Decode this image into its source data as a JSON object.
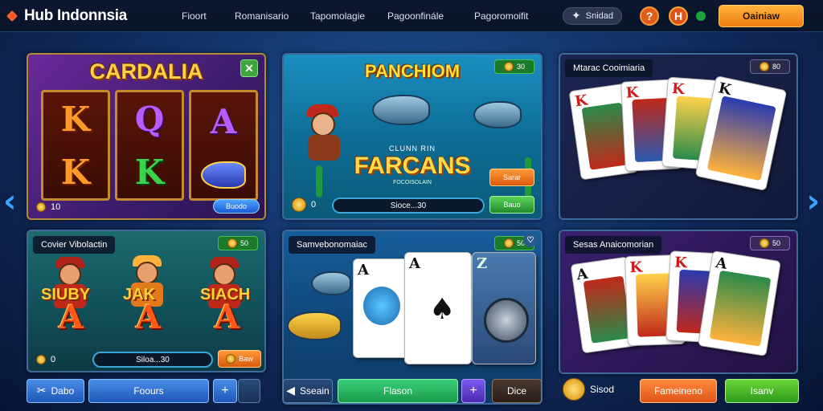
{
  "header": {
    "logo_text": "Hub Indonnsia",
    "nav": [
      "Fioort",
      "Romanisario",
      "Tapomolagie",
      "Pagoonfinále",
      "Pagoromoifit"
    ],
    "pill_label": "Snidad",
    "help_label": "?",
    "h_label": "H",
    "cta_label": "Oainiaw"
  },
  "cards": {
    "c1": {
      "title": "CARDALIA",
      "footer_value": "10",
      "footer_btn": "Buodo",
      "reel1": [
        "K",
        "K"
      ],
      "reel2": [
        "Q",
        "K"
      ],
      "reel3": [
        "A"
      ]
    },
    "c2": {
      "title": "PANCHIOM",
      "badge": "30",
      "sub": "CLUNN RIN",
      "main": "FARCANS",
      "sub2": "FOCOISOLAIN",
      "pink_btn": "Sarar",
      "footer_value": "0",
      "field": "Sioce...30",
      "green_btn": "Bauo"
    },
    "c3": {
      "title": "Mtarac Cooimiaria",
      "badge": "80",
      "cards": [
        "K",
        "K",
        "K",
        "K"
      ]
    },
    "c4": {
      "title": "Covier Vibolactin",
      "badge": "50",
      "words": [
        "SIUBY",
        "JAK",
        "SIACH"
      ],
      "letters": [
        "A",
        "A",
        "A"
      ],
      "footer_value": "0",
      "field": "Siloa...30",
      "btn": "Baw"
    },
    "c5": {
      "title": "Samvebonomaiac",
      "badge": "50",
      "card1": "A",
      "card2": "A",
      "card3": "Z"
    },
    "c6": {
      "title": "Sesas Anaicomorian",
      "badge": "50",
      "cards": [
        "A",
        "K",
        "K",
        "A"
      ]
    }
  },
  "bottom": {
    "b1": "Dabo",
    "b2": "Foours",
    "b3": "+",
    "b4": "Sseain",
    "b5": "Flason",
    "b6": "+",
    "b7": "Dice",
    "coin_label": "Sisod",
    "b8": "Fameineno",
    "b9": "Isanv"
  },
  "colors": {
    "accent": "#ef7d12",
    "brand": "#ff5a2a",
    "arrow": "#3aa3ff"
  }
}
